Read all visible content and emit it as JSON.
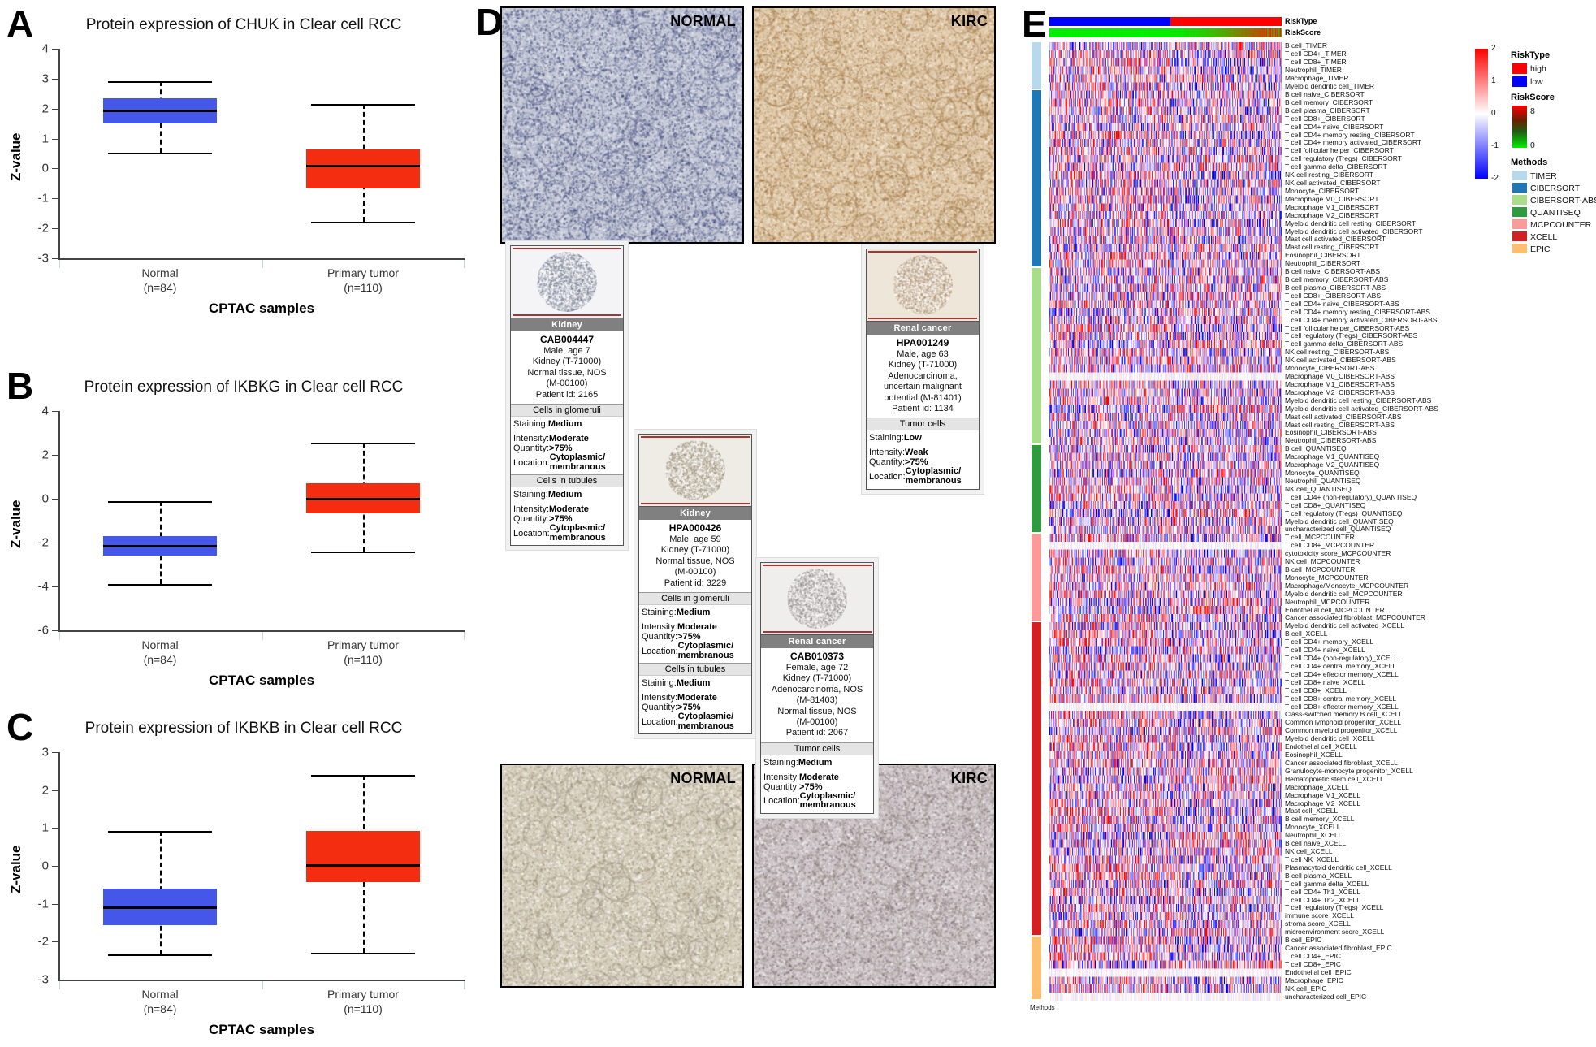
{
  "figure": {
    "panels": [
      "A",
      "B",
      "C",
      "D",
      "E"
    ]
  },
  "chart_data": [
    {
      "panel": "A",
      "type": "box",
      "title": "Protein expression of CHUK in Clear cell RCC",
      "xlabel": "CPTAC samples",
      "ylabel": "Z-value",
      "ylim": [
        -3,
        4
      ],
      "yticks": [
        "4",
        "3",
        "2",
        "1",
        "0",
        "-1",
        "-2",
        "-3"
      ],
      "categories": [
        "Normal",
        "Primary tumor"
      ],
      "category_sublabels": [
        "(n=84)",
        "(n=110)"
      ],
      "boxes": [
        {
          "name": "Normal",
          "color": "#4457e8",
          "min": 0.54,
          "q1": 1.5,
          "median": 1.92,
          "q3": 2.35,
          "max": 2.91
        },
        {
          "name": "Primary tumor",
          "color": "#f42c10",
          "min": -1.78,
          "q1": -0.66,
          "median": 0.07,
          "q3": 0.64,
          "max": 2.16
        }
      ]
    },
    {
      "panel": "B",
      "type": "box",
      "title": "Protein expression of IKBKG in Clear cell RCC",
      "xlabel": "CPTAC samples",
      "ylabel": "Z-value",
      "ylim": [
        -6,
        4
      ],
      "yticks": [
        "4",
        "2",
        "0",
        "-2",
        "-4",
        "-6"
      ],
      "categories": [
        "Normal",
        "Primary tumor"
      ],
      "category_sublabels": [
        "(n=84)",
        "(n=110)"
      ],
      "boxes": [
        {
          "name": "Normal",
          "color": "#4457e8",
          "min": -3.9,
          "q1": -2.59,
          "median": -2.15,
          "q3": -1.7,
          "max": -0.1
        },
        {
          "name": "Primary tumor",
          "color": "#f42c10",
          "min": -2.42,
          "q1": -0.67,
          "median": 0.0,
          "q3": 0.72,
          "max": 2.54
        }
      ]
    },
    {
      "panel": "C",
      "type": "box",
      "title": "Protein expression of IKBKB in Clear cell RCC",
      "xlabel": "CPTAC samples",
      "ylabel": "Z-value",
      "ylim": [
        -3,
        3
      ],
      "yticks": [
        "3",
        "2",
        "1",
        "0",
        "-1",
        "-2",
        "-3"
      ],
      "categories": [
        "Normal",
        "Primary tumor"
      ],
      "category_sublabels": [
        "(n=84)",
        "(n=110)"
      ],
      "boxes": [
        {
          "name": "Normal",
          "color": "#4457e8",
          "min": -2.33,
          "q1": -1.57,
          "median": -1.11,
          "q3": -0.59,
          "max": 0.92
        },
        {
          "name": "Primary tumor",
          "color": "#f42c10",
          "min": -2.29,
          "q1": -0.42,
          "median": 0.01,
          "q3": 0.92,
          "max": 2.4
        }
      ]
    }
  ],
  "panelD": {
    "micrographs": [
      {
        "id": "top-left",
        "caption": "NORMAL"
      },
      {
        "id": "top-right",
        "caption": "KIRC"
      },
      {
        "id": "bottom-left",
        "caption": "NORMAL"
      },
      {
        "id": "bottom-right",
        "caption": "KIRC"
      }
    ],
    "cards": [
      {
        "key": "cab004447",
        "tissue_title": "Kidney",
        "antibody": "CAB004447",
        "meta": [
          "Male, age 7",
          "Kidney (T-71000)",
          "Normal tissue, NOS",
          "(M-00100)",
          "Patient id: 2165"
        ],
        "sections": [
          {
            "header": "Cells in glomeruli",
            "staining_label": "Staining:",
            "staining": "Medium",
            "intensity_label": "Intensity:",
            "intensity": "Moderate",
            "quantity_label": "Quantity:",
            "quantity": ">75%",
            "location_label": "Location:",
            "location_line1": "Cytoplasmic/",
            "location_line2": "membranous"
          },
          {
            "header": "Cells in tubules",
            "staining_label": "Staining:",
            "staining": "Medium",
            "intensity_label": "Intensity:",
            "intensity": "Moderate",
            "quantity_label": "Quantity:",
            "quantity": ">75%",
            "location_label": "Location:",
            "location_line1": "Cytoplasmic/",
            "location_line2": "membranous"
          }
        ]
      },
      {
        "key": "hpa000426",
        "tissue_title": "Kidney",
        "antibody": "HPA000426",
        "meta": [
          "Male, age 59",
          "Kidney (T-71000)",
          "Normal tissue, NOS",
          "(M-00100)",
          "Patient id: 3229"
        ],
        "sections": [
          {
            "header": "Cells in glomeruli",
            "staining_label": "Staining:",
            "staining": "Medium",
            "intensity_label": "Intensity:",
            "intensity": "Moderate",
            "quantity_label": "Quantity:",
            "quantity": ">75%",
            "location_label": "Location:",
            "location_line1": "Cytoplasmic/",
            "location_line2": "membranous"
          },
          {
            "header": "Cells in tubules",
            "staining_label": "Staining:",
            "staining": "Medium",
            "intensity_label": "Intensity:",
            "intensity": "Moderate",
            "quantity_label": "Quantity:",
            "quantity": ">75%",
            "location_label": "Location:",
            "location_line1": "Cytoplasmic/",
            "location_line2": "membranous"
          }
        ]
      },
      {
        "key": "hpa001249",
        "tissue_title": "Renal cancer",
        "antibody": "HPA001249",
        "meta": [
          "Male, age 63",
          "Kidney (T-71000)",
          "Adenocarcinoma,",
          "uncertain malignant",
          "potential (M-81401)",
          "Patient id: 1134"
        ],
        "sections": [
          {
            "header": "Tumor cells",
            "staining_label": "Staining:",
            "staining": "Low",
            "intensity_label": "Intensity:",
            "intensity": "Weak",
            "quantity_label": "Quantity:",
            "quantity": ">75%",
            "location_label": "Location:",
            "location_line1": "Cytoplasmic/",
            "location_line2": "membranous"
          }
        ]
      },
      {
        "key": "cab010373",
        "tissue_title": "Renal cancer",
        "antibody": "CAB010373",
        "meta": [
          "Female, age 72",
          "Kidney (T-71000)",
          "Adenocarcinoma, NOS",
          "(M-81403)",
          "Normal tissue, NOS",
          "(M-00100)",
          "Patient id: 2067"
        ],
        "sections": [
          {
            "header": "Tumor cells",
            "staining_label": "Staining:",
            "staining": "Medium",
            "intensity_label": "Intensity:",
            "intensity": "Moderate",
            "quantity_label": "Quantity:",
            "quantity": ">75%",
            "location_label": "Location:",
            "location_line1": "Cytoplasmic/",
            "location_line2": "membranous"
          }
        ]
      }
    ]
  },
  "panelE": {
    "annotations": [
      {
        "name": "RiskType",
        "label": "RiskType"
      },
      {
        "name": "RiskScore",
        "label": "RiskScore"
      }
    ],
    "side_axis_label": "Methods",
    "legends": [
      {
        "name": "expression-scale",
        "type": "gradient",
        "ticks": [
          "2",
          "1",
          "0",
          "-1",
          "-2"
        ],
        "high_color": "#ff0000",
        "mid_color": "#ffffff",
        "low_color": "#0000ff"
      },
      {
        "name": "RiskType",
        "title": "RiskType",
        "items": [
          {
            "label": "high",
            "color": "#ff0000"
          },
          {
            "label": "low",
            "color": "#0000ff"
          }
        ]
      },
      {
        "name": "RiskScore",
        "title": "RiskScore",
        "ticks": [
          "8",
          "0"
        ],
        "high_color": "#ff0000",
        "low_color": "#00ee00"
      },
      {
        "name": "Methods",
        "title": "Methods",
        "items": [
          {
            "label": "TIMER",
            "color": "#b8d8ec"
          },
          {
            "label": "CIBERSORT",
            "color": "#1f78b4"
          },
          {
            "label": "CIBERSORT-ABS",
            "color": "#a9dd8c"
          },
          {
            "label": "QUANTISEQ",
            "color": "#2e9b3e"
          },
          {
            "label": "MCPCOUNTER",
            "color": "#fb9a99"
          },
          {
            "label": "XCELL",
            "color": "#d32020"
          },
          {
            "label": "EPIC",
            "color": "#fdbf6f"
          }
        ]
      }
    ],
    "method_groups": [
      {
        "method": "TIMER",
        "color": "#b8d8ec",
        "rows": [
          "B cell_TIMER",
          "T cell CD4+_TIMER",
          "T cell CD8+_TIMER",
          "Neutrophil_TIMER",
          "Macrophage_TIMER",
          "Myeloid dendritic cell_TIMER"
        ]
      },
      {
        "method": "CIBERSORT",
        "color": "#1f78b4",
        "rows": [
          "B cell naive_CIBERSORT",
          "B cell memory_CIBERSORT",
          "B cell plasma_CIBERSORT",
          "T cell CD8+_CIBERSORT",
          "T cell CD4+ naive_CIBERSORT",
          "T cell CD4+ memory resting_CIBERSORT",
          "T cell CD4+ memory activated_CIBERSORT",
          "T cell follicular helper_CIBERSORT",
          "T cell regulatory (Tregs)_CIBERSORT",
          "T cell gamma delta_CIBERSORT",
          "NK cell resting_CIBERSORT",
          "NK cell activated_CIBERSORT",
          "Monocyte_CIBERSORT",
          "Macrophage M0_CIBERSORT",
          "Macrophage M1_CIBERSORT",
          "Macrophage M2_CIBERSORT",
          "Myeloid dendritic cell resting_CIBERSORT",
          "Myeloid dendritic cell activated_CIBERSORT",
          "Mast cell activated_CIBERSORT",
          "Mast cell resting_CIBERSORT",
          "Eosinophil_CIBERSORT",
          "Neutrophil_CIBERSORT"
        ]
      },
      {
        "method": "CIBERSORT-ABS",
        "color": "#a9dd8c",
        "rows": [
          "B cell naive_CIBERSORT-ABS",
          "B cell memory_CIBERSORT-ABS",
          "B cell plasma_CIBERSORT-ABS",
          "T cell CD8+_CIBERSORT-ABS",
          "T cell CD4+ naive_CIBERSORT-ABS",
          "T cell CD4+ memory resting_CIBERSORT-ABS",
          "T cell CD4+ memory activated_CIBERSORT-ABS",
          "T cell follicular helper_CIBERSORT-ABS",
          "T cell regulatory (Tregs)_CIBERSORT-ABS",
          "T cell gamma delta_CIBERSORT-ABS",
          "NK cell resting_CIBERSORT-ABS",
          "NK cell activated_CIBERSORT-ABS",
          "Monocyte_CIBERSORT-ABS",
          "Macrophage M0_CIBERSORT-ABS",
          "Macrophage M1_CIBERSORT-ABS",
          "Macrophage M2_CIBERSORT-ABS",
          "Myeloid dendritic cell resting_CIBERSORT-ABS",
          "Myeloid dendritic cell activated_CIBERSORT-ABS",
          "Mast cell activated_CIBERSORT-ABS",
          "Mast cell resting_CIBERSORT-ABS",
          "Eosinophil_CIBERSORT-ABS",
          "Neutrophil_CIBERSORT-ABS"
        ]
      },
      {
        "method": "QUANTISEQ",
        "color": "#2e9b3e",
        "rows": [
          "B cell_QUANTISEQ",
          "Macrophage M1_QUANTISEQ",
          "Macrophage M2_QUANTISEQ",
          "Monocyte_QUANTISEQ",
          "Neutrophil_QUANTISEQ",
          "NK cell_QUANTISEQ",
          "T cell CD4+ (non-regulatory)_QUANTISEQ",
          "T cell CD8+_QUANTISEQ",
          "T cell regulatory (Tregs)_QUANTISEQ",
          "Myeloid dendritic cell_QUANTISEQ",
          "uncharacterized cell_QUANTISEQ"
        ]
      },
      {
        "method": "MCPCOUNTER",
        "color": "#fb9a99",
        "rows": [
          "T cell_MCPCOUNTER",
          "T cell CD8+_MCPCOUNTER",
          "cytotoxicity score_MCPCOUNTER",
          "NK cell_MCPCOUNTER",
          "B cell_MCPCOUNTER",
          "Monocyte_MCPCOUNTER",
          "Macrophage/Monocyte_MCPCOUNTER",
          "Myeloid dendritic cell_MCPCOUNTER",
          "Neutrophil_MCPCOUNTER",
          "Endothelial cell_MCPCOUNTER",
          "Cancer associated fibroblast_MCPCOUNTER"
        ]
      },
      {
        "method": "XCELL",
        "color": "#d32020",
        "rows": [
          "Myeloid dendritic cell activated_XCELL",
          "B cell_XCELL",
          "T cell CD4+ memory_XCELL",
          "T cell CD4+ naive_XCELL",
          "T cell CD4+ (non-regulatory)_XCELL",
          "T cell CD4+ central memory_XCELL",
          "T cell CD4+ effector memory_XCELL",
          "T cell CD8+ naive_XCELL",
          "T cell CD8+_XCELL",
          "T cell CD8+ central memory_XCELL",
          "T cell CD8+ effector memory_XCELL",
          "Class-switched memory B cell_XCELL",
          "Common lymphoid progenitor_XCELL",
          "Common myeloid progenitor_XCELL",
          "Myeloid dendritic cell_XCELL",
          "Endothelial cell_XCELL",
          "Eosinophil_XCELL",
          "Cancer associated fibroblast_XCELL",
          "Granulocyte-monocyte progenitor_XCELL",
          "Hematopoietic stem cell_XCELL",
          "Macrophage_XCELL",
          "Macrophage M1_XCELL",
          "Macrophage M2_XCELL",
          "Mast cell_XCELL",
          "B cell memory_XCELL",
          "Monocyte_XCELL",
          "Neutrophil_XCELL",
          "B cell naive_XCELL",
          "NK cell_XCELL",
          "T cell NK_XCELL",
          "Plasmacytoid dendritic cell_XCELL",
          "B cell plasma_XCELL",
          "T cell gamma delta_XCELL",
          "T cell CD4+ Th1_XCELL",
          "T cell CD4+ Th2_XCELL",
          "T cell regulatory (Tregs)_XCELL",
          "immune score_XCELL",
          "stroma score_XCELL",
          "microenvironment score_XCELL"
        ]
      },
      {
        "method": "EPIC",
        "color": "#fdbf6f",
        "rows": [
          "B cell_EPIC",
          "Cancer associated fibroblast_EPIC",
          "T cell CD4+_EPIC",
          "T cell CD8+_EPIC",
          "Endothelial cell_EPIC",
          "Macrophage_EPIC",
          "NK cell_EPIC",
          "uncharacterized cell_EPIC"
        ]
      }
    ]
  }
}
